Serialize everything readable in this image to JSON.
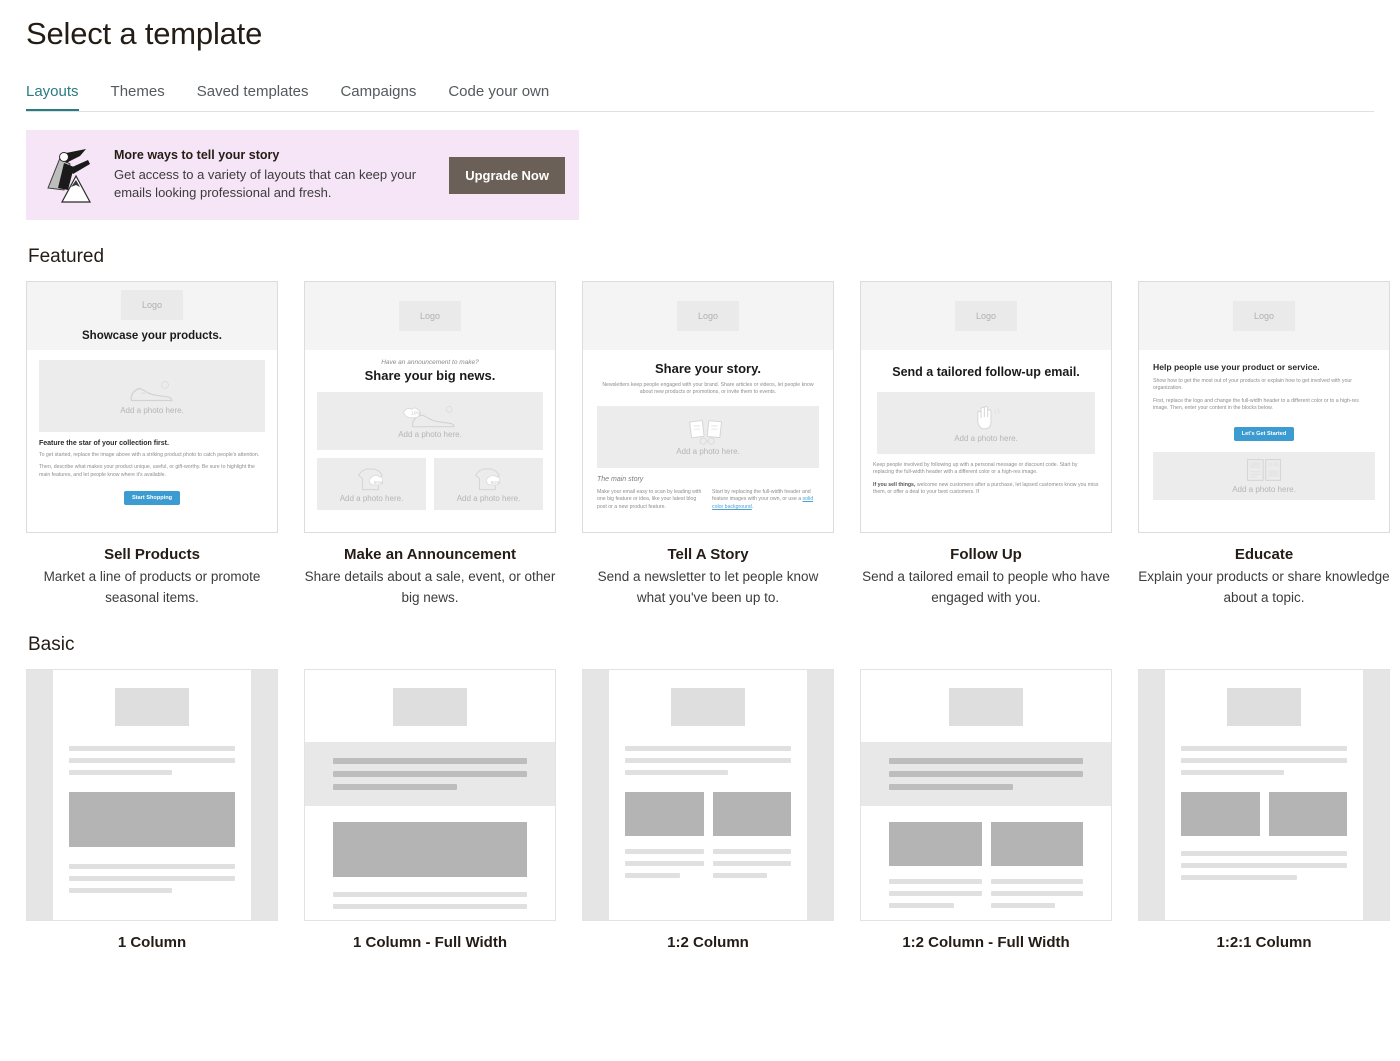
{
  "header": {
    "title": "Select a template"
  },
  "tabs": [
    {
      "label": "Layouts",
      "active": true
    },
    {
      "label": "Themes",
      "active": false
    },
    {
      "label": "Saved templates",
      "active": false
    },
    {
      "label": "Campaigns",
      "active": false
    },
    {
      "label": "Code your own",
      "active": false
    }
  ],
  "promo": {
    "title": "More ways to tell your story",
    "body": "Get access to a variety of layouts that can keep your emails looking professional and fresh.",
    "button": "Upgrade Now",
    "background": "#f6e5f6",
    "button_color": "#6b6057",
    "art": "superhero-mountain-illustration"
  },
  "sections": {
    "featured_title": "Featured",
    "basic_title": "Basic"
  },
  "featured": [
    {
      "name": "Sell Products",
      "description": "Market a line of products or promote seasonal items.",
      "preview": {
        "logo": "Logo",
        "heading": "Showcase your products.",
        "photo_label": "Add a photo here.",
        "subhead": "Feature the star of your collection first.",
        "para1": "To get started, replace the image above with a striking product photo to catch people's attention.",
        "para2": "Then, describe what makes your product unique, useful, or gift-worthy. Be sure to highlight the main features, and let people know where it's available.",
        "button": "Start Shopping",
        "button_color": "#3c9bd0",
        "icon": "shoe-icon"
      }
    },
    {
      "name": "Make an Announcement",
      "description": "Share details about a sale, event, or other big news.",
      "preview": {
        "logo": "Logo",
        "kicker": "Have an announcement to make?",
        "heading": "Share your big news.",
        "photo_label": "Add a photo here.",
        "photo_label_2": "Add a photo here.",
        "photo_label_3": "Add a photo here.",
        "icon": "shoe-discount-icon",
        "icon_2": "shirt-discount-icon",
        "icon_3": "shirt-discount-icon"
      }
    },
    {
      "name": "Tell A Story",
      "description": "Send a newsletter to let people know what you've been up to.",
      "preview": {
        "logo": "Logo",
        "heading": "Share your story.",
        "intro": "Newsletters keep people engaged with your brand. Share articles or videos, let people know about new products or promotions, or invite them to events.",
        "photo_label": "Add a photo here.",
        "section_label": "The main story",
        "col1": "Make your email easy to scan by leading with one big feature or idea, like your latest blog post or a new product feature.",
        "col2_a": "Start by replacing the full-width header and feature images with your own, or use a ",
        "col2_link": "solid color background",
        "col2_b": ".",
        "link_color": "#4aa3d8",
        "icon": "books-glasses-icon"
      }
    },
    {
      "name": "Follow Up",
      "description": "Send a tailored email to people who have engaged with you.",
      "preview": {
        "logo": "Logo",
        "heading": "Send a tailored follow-up email.",
        "photo_label": "Add a photo here.",
        "para1": "Keep people involved by following up with a personal message or discount code. Start by replacing the full-width header with a different color or a high-res image.",
        "para2_bold": "If you sell things,",
        "para2": " welcome new customers after a purchase, let lapsed customers know you miss them, or offer a deal to your best customers. If",
        "icon": "waving-hand-icon"
      }
    },
    {
      "name": "Educate",
      "description": "Explain your products or share knowledge about a topic.",
      "preview": {
        "logo": "Logo",
        "heading": "Help people use your product or service.",
        "para1": "Show how to get the most out of your products or explain how to get involved with your organization.",
        "para2": "First, replace the logo and change the full-width header to a different color or to a high-res image. Then, enter your content in the blocks below.",
        "button": "Let's Get Started",
        "button_color": "#3c9bd0",
        "photo_label": "Add a photo here.",
        "icon": "layout-page-icon"
      }
    }
  ],
  "basic": [
    {
      "name": "1 Column",
      "full_width": false,
      "columns": 1
    },
    {
      "name": "1 Column - Full Width",
      "full_width": true,
      "columns": 1
    },
    {
      "name": "1:2 Column",
      "full_width": false,
      "columns": 2
    },
    {
      "name": "1:2 Column - Full Width",
      "full_width": true,
      "columns": 2
    },
    {
      "name": "1:2:1 Column",
      "full_width": false,
      "columns": 2
    }
  ]
}
